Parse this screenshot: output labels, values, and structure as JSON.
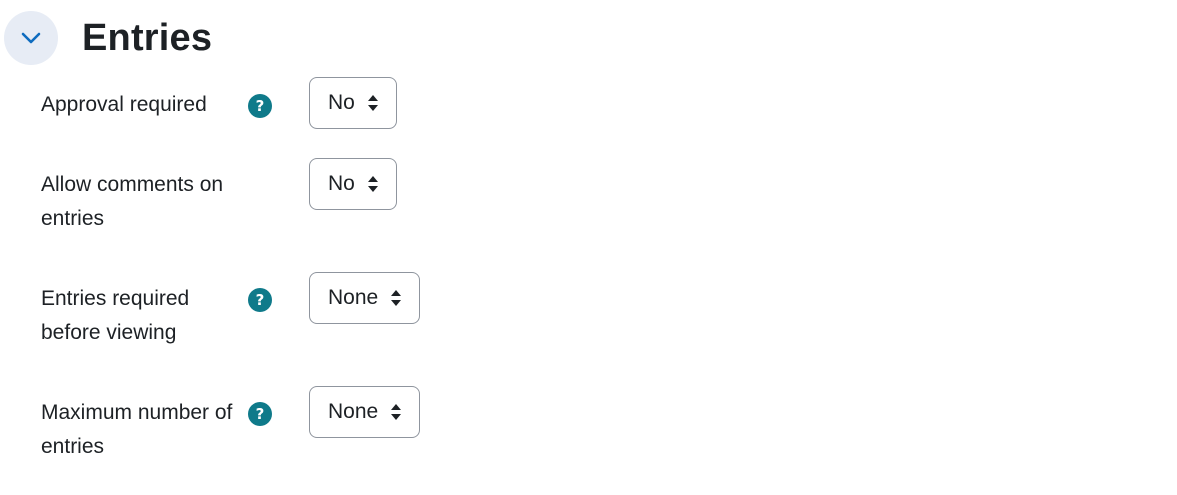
{
  "section": {
    "title": "Entries",
    "toggle_icon": "chevron-down-icon",
    "accent": "#0f6cbf"
  },
  "rows": [
    {
      "label": "Approval required",
      "has_help": true,
      "value": "No"
    },
    {
      "label": "Allow comments on entries",
      "has_help": false,
      "value": "No"
    },
    {
      "label": "Entries required before viewing",
      "has_help": true,
      "value": "None"
    },
    {
      "label": "Maximum number of entries",
      "has_help": true,
      "value": "None"
    }
  ],
  "help_icon": {
    "glyph": "?",
    "color": "#0f7a8a"
  }
}
